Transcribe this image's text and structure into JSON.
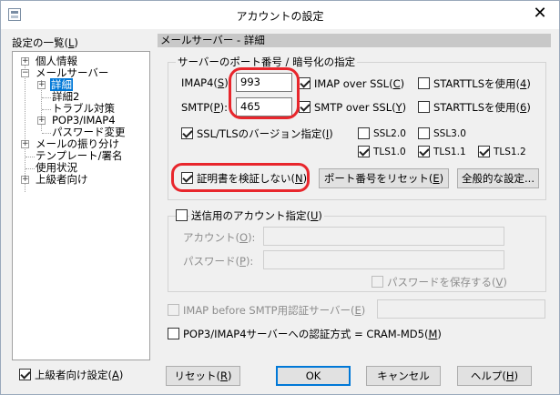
{
  "window": {
    "title": "アカウントの設定",
    "close_glyph": "✕"
  },
  "sidebar": {
    "heading": "設定の一覧(",
    "heading_key": "L",
    "heading_end": ")",
    "tree": [
      {
        "label": "個人情報"
      },
      {
        "label": "メールサーバー"
      },
      {
        "label": "詳細"
      },
      {
        "label": "詳細2"
      },
      {
        "label": "トラブル対策"
      },
      {
        "label": "POP3/IMAP4"
      },
      {
        "label": "パスワード変更"
      },
      {
        "label": "メールの振り分け"
      },
      {
        "label": "テンプレート/署名"
      },
      {
        "label": "使用状況"
      },
      {
        "label": "上級者向け"
      }
    ],
    "advanced_checkbox": "上級者向け設定(",
    "advanced_key": "A",
    "advanced_end": ")"
  },
  "panel": {
    "header": "メールサーバー - 詳細",
    "port_group_title": "サーバーのポート番号 / 暗号化の指定",
    "imap_label": "IMAP4(",
    "imap_key": "S",
    "imap_end": "):",
    "imap_value": "993",
    "smtp_label": "SMTP(",
    "smtp_key": "P",
    "smtp_end": "):",
    "smtp_value": "465",
    "imap_ssl": "IMAP over SSL(",
    "imap_ssl_key": "C",
    "imap_ssl_end": ")",
    "smtp_ssl": "SMTP over SSL(",
    "smtp_ssl_key": "Y",
    "smtp_ssl_end": ")",
    "starttls1": "STARTTLSを使用(",
    "starttls1_key": "4",
    "starttls1_end": ")",
    "starttls2": "STARTTLSを使用(",
    "starttls2_key": "6",
    "starttls2_end": ")",
    "ssl_version": "SSL/TLSのバージョン指定(",
    "ssl_version_key": "I",
    "ssl_version_end": ")",
    "ssl20": "SSL2.0",
    "ssl30": "SSL3.0",
    "tls10": "TLS1.0",
    "tls11": "TLS1.1",
    "tls12": "TLS1.2",
    "verify_cert": "証明書を検証しない(",
    "verify_cert_key": "N",
    "verify_cert_end": ")",
    "reset_port_btn": "ポート番号をリセット(",
    "reset_port_key": "E",
    "reset_port_end": ")",
    "general_settings_btn": "全般的な設定..."
  },
  "send_group": {
    "title": "送信用のアカウント指定(",
    "title_key": "U",
    "title_end": ")",
    "account_label": "アカウント(",
    "account_key": "O",
    "account_end": "):",
    "account_value": "",
    "password_label": "パスワード(",
    "password_key": "P",
    "password_end": "):",
    "password_value": "",
    "save_password": "パスワードを保存する(",
    "save_password_key": "V",
    "save_password_end": ")"
  },
  "imap_before_smtp": {
    "label": "IMAP before SMTP用認証サーバー(",
    "key": "E",
    "end": ")",
    "value": ""
  },
  "cram": {
    "label": "POP3/IMAP4サーバーへの認証方式 = CRAM-MD5(",
    "key": "M",
    "end": ")"
  },
  "footer": {
    "reset": "リセット(",
    "reset_key": "R",
    "reset_end": ")",
    "ok": "OK",
    "cancel": "キャンセル",
    "help": "ヘルプ(",
    "help_key": "H",
    "help_end": ")"
  },
  "colors": {
    "highlight_ring": "#e8262c",
    "selection": "#0078d7"
  }
}
